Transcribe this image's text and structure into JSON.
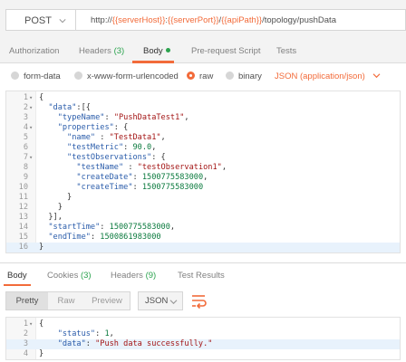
{
  "request": {
    "method": "POST",
    "url_parts": [
      {
        "t": "http://",
        "v": false
      },
      {
        "t": "{{serverHost}}",
        "v": true
      },
      {
        "t": ":",
        "v": false
      },
      {
        "t": "{{serverPort}}",
        "v": true
      },
      {
        "t": "/",
        "v": false
      },
      {
        "t": "{{apiPath}}",
        "v": true
      },
      {
        "t": "/topology/pushData",
        "v": false
      }
    ]
  },
  "request_tabs": {
    "authorization": "Authorization",
    "headers": "Headers",
    "headers_count": "(3)",
    "body": "Body",
    "prerequest": "Pre-request Script",
    "tests": "Tests"
  },
  "body_options": {
    "form_data": "form-data",
    "urlencoded": "x-www-form-urlencoded",
    "raw": "raw",
    "binary": "binary",
    "content_type": "JSON (application/json)"
  },
  "request_body": [
    {
      "no": "1",
      "fold": "▾",
      "code": "{"
    },
    {
      "no": "2",
      "fold": "▾",
      "code": "  \"data\":[{"
    },
    {
      "no": "3",
      "fold": "",
      "code": "    \"typeName\": \"PushDataTest1\","
    },
    {
      "no": "4",
      "fold": "▾",
      "code": "    \"properties\": {"
    },
    {
      "no": "5",
      "fold": "",
      "code": "      \"name\" : \"TestData1\","
    },
    {
      "no": "6",
      "fold": "",
      "code": "      \"testMetric\": 90.0,"
    },
    {
      "no": "7",
      "fold": "▾",
      "code": "      \"testObservations\": {"
    },
    {
      "no": "8",
      "fold": "",
      "code": "        \"testName\" : \"testObservation1\","
    },
    {
      "no": "9",
      "fold": "",
      "code": "        \"createDate\": 1500775583000,"
    },
    {
      "no": "10",
      "fold": "",
      "code": "        \"createTime\": 1500775583000"
    },
    {
      "no": "11",
      "fold": "",
      "code": "      }"
    },
    {
      "no": "12",
      "fold": "",
      "code": "    }"
    },
    {
      "no": "13",
      "fold": "",
      "code": "  }],"
    },
    {
      "no": "14",
      "fold": "",
      "code": "  \"startTime\": 1500775583000,"
    },
    {
      "no": "15",
      "fold": "",
      "code": "  \"endTime\": 1500861983000"
    },
    {
      "no": "16",
      "fold": "",
      "code": "}"
    }
  ],
  "response_tabs": {
    "body": "Body",
    "cookies": "Cookies",
    "cookies_count": "(3)",
    "headers": "Headers",
    "headers_count": "(9)",
    "test_results": "Test Results"
  },
  "response_toolbar": {
    "pretty": "Pretty",
    "raw": "Raw",
    "preview": "Preview",
    "format": "JSON"
  },
  "response_body": [
    {
      "no": "1",
      "fold": "▾",
      "code": "{"
    },
    {
      "no": "2",
      "fold": "",
      "code": "    \"status\": 1,"
    },
    {
      "no": "3",
      "fold": "",
      "code": "    \"data\": \"Push data successfully.\""
    },
    {
      "no": "4",
      "fold": "",
      "code": "}"
    }
  ],
  "colors": {
    "accent": "#f26b3a",
    "count_green": "#2ba34e",
    "line_highlight": "#e8f2fc"
  },
  "icons": [
    "chevron-down-icon",
    "wrap-lines-icon",
    "fold-arrow-icon"
  ]
}
